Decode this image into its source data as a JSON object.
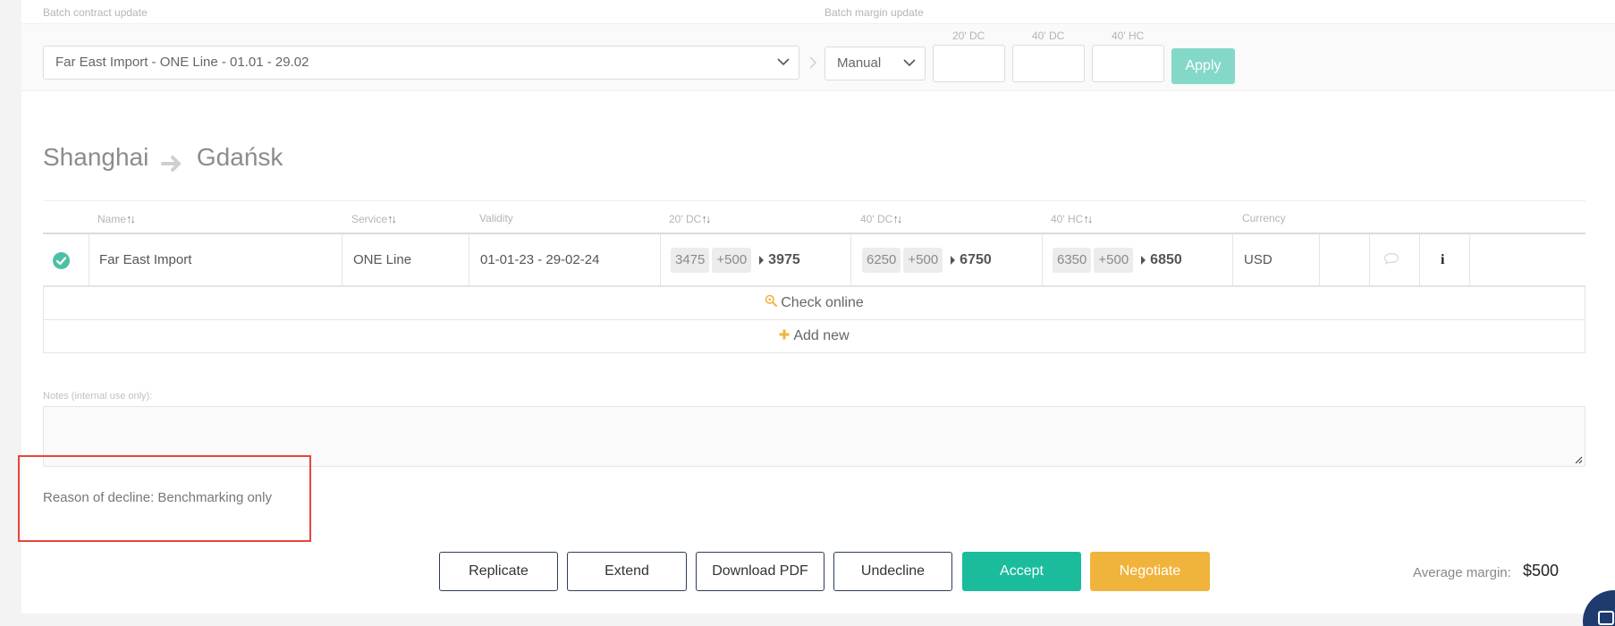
{
  "batch": {
    "contract_label": "Batch contract update",
    "margin_label": "Batch margin update",
    "contract_value": "Far East Import - ONE Line - 01.01 - 29.02",
    "margin_mode": "Manual",
    "columns": [
      "20' DC",
      "40' DC",
      "40' HC"
    ],
    "apply_label": "Apply"
  },
  "route": {
    "origin": "Shanghai",
    "destination": "Gdańsk"
  },
  "table": {
    "headers": {
      "name": "Name",
      "service": "Service",
      "validity": "Validity",
      "dc20": "20' DC",
      "dc40": "40' DC",
      "hc40": "40' HC",
      "currency": "Currency"
    },
    "row": {
      "name": "Far East Import",
      "service": "ONE Line",
      "validity": "01-01-23 - 29-02-24",
      "dc20": {
        "base": "3475",
        "margin": "+500",
        "total": "3975"
      },
      "dc40": {
        "base": "6250",
        "margin": "+500",
        "total": "6750"
      },
      "hc40": {
        "base": "6350",
        "margin": "+500",
        "total": "6850"
      },
      "currency": "USD"
    },
    "check_online": "Check online",
    "add_new": "Add new"
  },
  "notes": {
    "label": "Notes (internal use only):",
    "value": ""
  },
  "reason": "Reason of decline: Benchmarking only",
  "actions": {
    "replicate": "Replicate",
    "extend": "Extend",
    "download_pdf": "Download PDF",
    "undecline": "Undecline",
    "accept": "Accept",
    "negotiate": "Negotiate"
  },
  "average_margin": {
    "label": "Average margin:",
    "value": "$500"
  },
  "colors": {
    "accent_green": "#1abc9c",
    "accent_orange": "#f0b43c",
    "highlight_red": "#e8453c",
    "navy": "#2c3e55"
  }
}
